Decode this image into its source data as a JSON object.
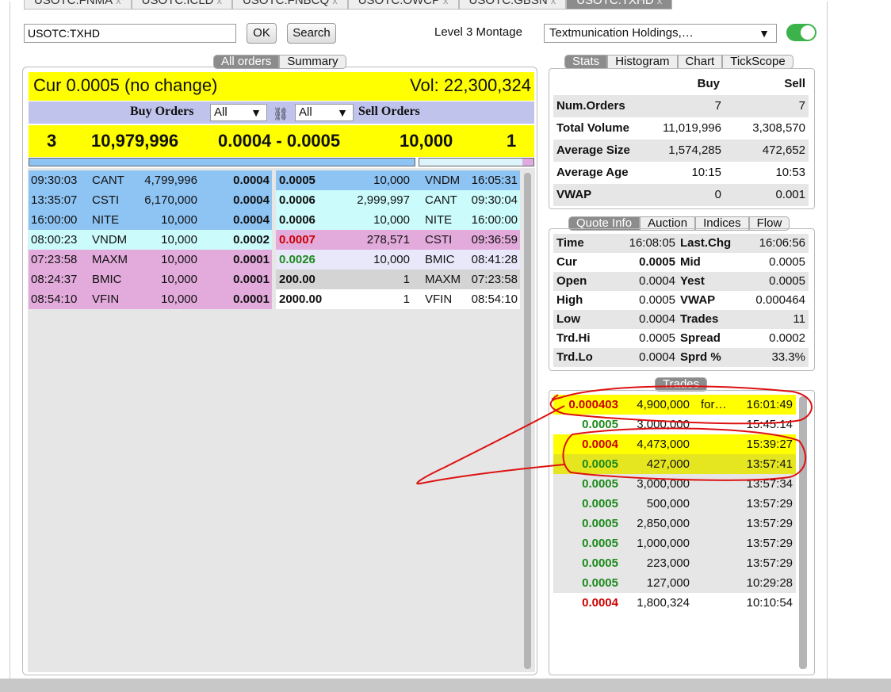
{
  "tabs": [
    {
      "label": "USOTC:FNMA",
      "close": "x"
    },
    {
      "label": "USOTC:ICLD",
      "close": "x"
    },
    {
      "label": "USOTC:FNBCQ",
      "close": "x"
    },
    {
      "label": "USOTC:OWCP",
      "close": "x"
    },
    {
      "label": "USOTC:GBSN",
      "close": "x"
    },
    {
      "label": "USOTC:TXHD",
      "close": "x"
    }
  ],
  "toolbar": {
    "symbol_value": "USOTC:TXHD",
    "ok_label": "OK",
    "search_label": "Search",
    "level3_label": "Level 3 Montage",
    "company": "Textmunication Holdings,…",
    "dropdown_arrow": "▼"
  },
  "left_tabs": {
    "all_orders": "All orders",
    "summary": "Summary"
  },
  "cur": {
    "text": "Cur 0.0005 (no change)",
    "vol": "Vol: 22,300,324"
  },
  "orders_header": {
    "buy": "Buy Orders",
    "sell": "Sell Orders",
    "buy_filter": "All",
    "sell_filter": "All",
    "link": "⛓"
  },
  "summary": {
    "buy_count": "3",
    "buy_volume": "10,979,996",
    "spread": "0.0004 - 0.0005",
    "sell_volume": "10,000",
    "sell_count": "1"
  },
  "colors": {
    "lightblue": "#8ec4f4",
    "cyan": "#ccfbfb",
    "pink": "#e3aadc",
    "lavender": "#e8e8fa",
    "grey": "#d4d4d4",
    "white": "#ffffff",
    "yellow": "#ffff00",
    "toggle": "#3bb34a"
  },
  "buy_orders": [
    {
      "time": "09:30:03",
      "mm": "CANT",
      "size": "4,799,996",
      "price": "0.0004",
      "color": "#8ec4f4"
    },
    {
      "time": "13:35:07",
      "mm": "CSTI",
      "size": "6,170,000",
      "price": "0.0004",
      "color": "#8ec4f4"
    },
    {
      "time": "16:00:00",
      "mm": "NITE",
      "size": "10,000",
      "price": "0.0004",
      "color": "#8ec4f4"
    },
    {
      "time": "08:00:23",
      "mm": "VNDM",
      "size": "10,000",
      "price": "0.0002",
      "color": "#ccfbfb"
    },
    {
      "time": "07:23:58",
      "mm": "MAXM",
      "size": "10,000",
      "price": "0.0001",
      "color": "#e3aadc"
    },
    {
      "time": "08:24:37",
      "mm": "BMIC",
      "size": "10,000",
      "price": "0.0001",
      "color": "#e3aadc"
    },
    {
      "time": "08:54:10",
      "mm": "VFIN",
      "size": "10,000",
      "price": "0.0001",
      "color": "#e3aadc"
    }
  ],
  "sell_orders": [
    {
      "price": "0.0005",
      "size": "10,000",
      "mm": "VNDM",
      "time": "16:05:31",
      "color": "#8ec4f4",
      "price_color": "#111111"
    },
    {
      "price": "0.0006",
      "size": "2,999,997",
      "mm": "CANT",
      "time": "09:30:04",
      "color": "#ccfbfb",
      "price_color": "#111111"
    },
    {
      "price": "0.0006",
      "size": "10,000",
      "mm": "NITE",
      "time": "16:00:00",
      "color": "#ccfbfb",
      "price_color": "#111111"
    },
    {
      "price": "0.0007",
      "size": "278,571",
      "mm": "CSTI",
      "time": "09:36:59",
      "color": "#e3aadc",
      "price_color": "#cc0000"
    },
    {
      "price": "0.0026",
      "size": "10,000",
      "mm": "BMIC",
      "time": "08:41:28",
      "color": "#e8e8fa",
      "price_color": "#1c8a1c"
    },
    {
      "price": "200.00",
      "size": "1",
      "mm": "MAXM",
      "time": "07:23:58",
      "color": "#d4d4d4",
      "price_color": "#111111"
    },
    {
      "price": "2000.00",
      "size": "1",
      "mm": "VFIN",
      "time": "08:54:10",
      "color": "#ffffff",
      "price_color": "#111111"
    }
  ],
  "right_tabs": {
    "stats": "Stats",
    "histogram": "Histogram",
    "chart": "Chart",
    "tickscope": "TickScope"
  },
  "stats": {
    "buy_header": "Buy",
    "sell_header": "Sell",
    "rows": [
      {
        "label": "Num.Orders",
        "buy": "7",
        "sell": "7"
      },
      {
        "label": "Total Volume",
        "buy": "11,019,996",
        "sell": "3,308,570"
      },
      {
        "label": "Average Size",
        "buy": "1,574,285",
        "sell": "472,652"
      },
      {
        "label": "Average Age",
        "buy": "10:15",
        "sell": "10:53"
      },
      {
        "label": "VWAP",
        "buy": "0",
        "sell": "0.001"
      }
    ]
  },
  "quote_tabs": {
    "quote_info": "Quote Info",
    "auction": "Auction",
    "indices": "Indices",
    "flow": "Flow"
  },
  "quote": [
    {
      "l1": "Time",
      "v1": "16:08:05",
      "l2": "Last.Chg",
      "v2": "16:06:56",
      "bold1": false
    },
    {
      "l1": "Cur",
      "v1": "0.0005",
      "l2": "Mid",
      "v2": "0.0005",
      "bold1": true
    },
    {
      "l1": "Open",
      "v1": "0.0004",
      "l2": "Yest",
      "v2": "0.0005",
      "bold1": false
    },
    {
      "l1": "High",
      "v1": "0.0005",
      "l2": "VWAP",
      "v2": "0.000464",
      "bold1": false
    },
    {
      "l1": "Low",
      "v1": "0.0004",
      "l2": "Trades",
      "v2": "11",
      "bold1": false
    },
    {
      "l1": "Trd.Hi",
      "v1": "0.0005",
      "l2": "Spread",
      "v2": "0.0002",
      "bold1": false
    },
    {
      "l1": "Trd.Lo",
      "v1": "0.0004",
      "l2": "Sprd %",
      "v2": "33.3%",
      "bold1": false
    }
  ],
  "trades_title": "Trades",
  "trades": [
    {
      "price": "0.000403",
      "size": "4,900,000",
      "cond": "for…",
      "time": "16:01:49",
      "pc": "red",
      "bg": "#ffff00"
    },
    {
      "price": "0.0005",
      "size": "3,000,000",
      "cond": "",
      "time": "15:45:14",
      "pc": "green",
      "bg": "#ffffff"
    },
    {
      "price": "0.0004",
      "size": "4,473,000",
      "cond": "",
      "time": "15:39:27",
      "pc": "red",
      "bg": "#ffff00"
    },
    {
      "price": "0.0005",
      "size": "427,000",
      "cond": "",
      "time": "13:57:41",
      "pc": "green",
      "bg": "#e6e620"
    },
    {
      "price": "0.0005",
      "size": "3,000,000",
      "cond": "",
      "time": "13:57:34",
      "pc": "green",
      "bg": "#e6e6e6"
    },
    {
      "price": "0.0005",
      "size": "500,000",
      "cond": "",
      "time": "13:57:29",
      "pc": "green",
      "bg": "#e6e6e6"
    },
    {
      "price": "0.0005",
      "size": "2,850,000",
      "cond": "",
      "time": "13:57:29",
      "pc": "green",
      "bg": "#e6e6e6"
    },
    {
      "price": "0.0005",
      "size": "1,000,000",
      "cond": "",
      "time": "13:57:29",
      "pc": "green",
      "bg": "#e6e6e6"
    },
    {
      "price": "0.0005",
      "size": "223,000",
      "cond": "",
      "time": "13:57:29",
      "pc": "green",
      "bg": "#e6e6e6"
    },
    {
      "price": "0.0005",
      "size": "127,000",
      "cond": "",
      "time": "10:29:28",
      "pc": "green",
      "bg": "#e6e6e6"
    },
    {
      "price": "0.0004",
      "size": "1,800,324",
      "cond": "",
      "time": "10:10:54",
      "pc": "red",
      "bg": "#ffffff"
    }
  ]
}
